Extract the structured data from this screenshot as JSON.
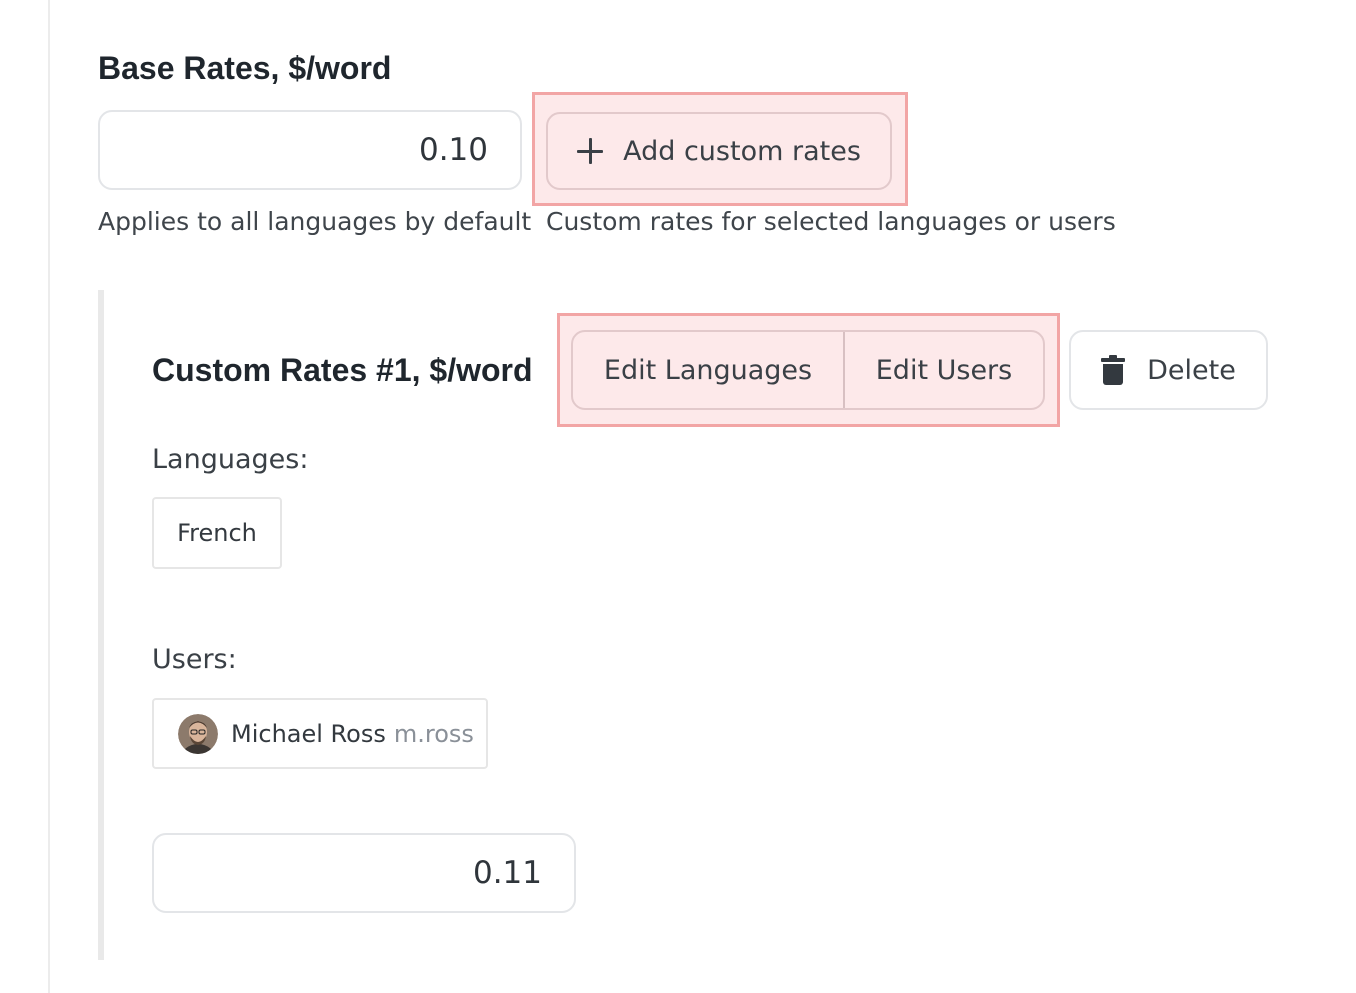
{
  "base_rates": {
    "title": "Base Rates, $/word",
    "rate_value": "0.10",
    "helper": "Applies to all languages by default"
  },
  "add_custom": {
    "button_label": "Add custom rates",
    "icon": "plus-icon",
    "helper": "Custom rates for selected languages or users"
  },
  "custom_rate_1": {
    "title": "Custom Rates #1, $/word",
    "edit_languages_label": "Edit Languages",
    "edit_users_label": "Edit Users",
    "delete_label": "Delete",
    "delete_icon": "trash-icon",
    "languages_label": "Languages:",
    "languages": [
      "French"
    ],
    "users_label": "Users:",
    "users": [
      {
        "name": "Michael Ross",
        "handle": "m.ross"
      }
    ],
    "rate_value": "0.11"
  },
  "colors": {
    "highlight_border": "#f2a5a5",
    "highlight_fill": "#fde9ea",
    "text_dark": "#1f262d",
    "text_muted": "#8a9098"
  }
}
